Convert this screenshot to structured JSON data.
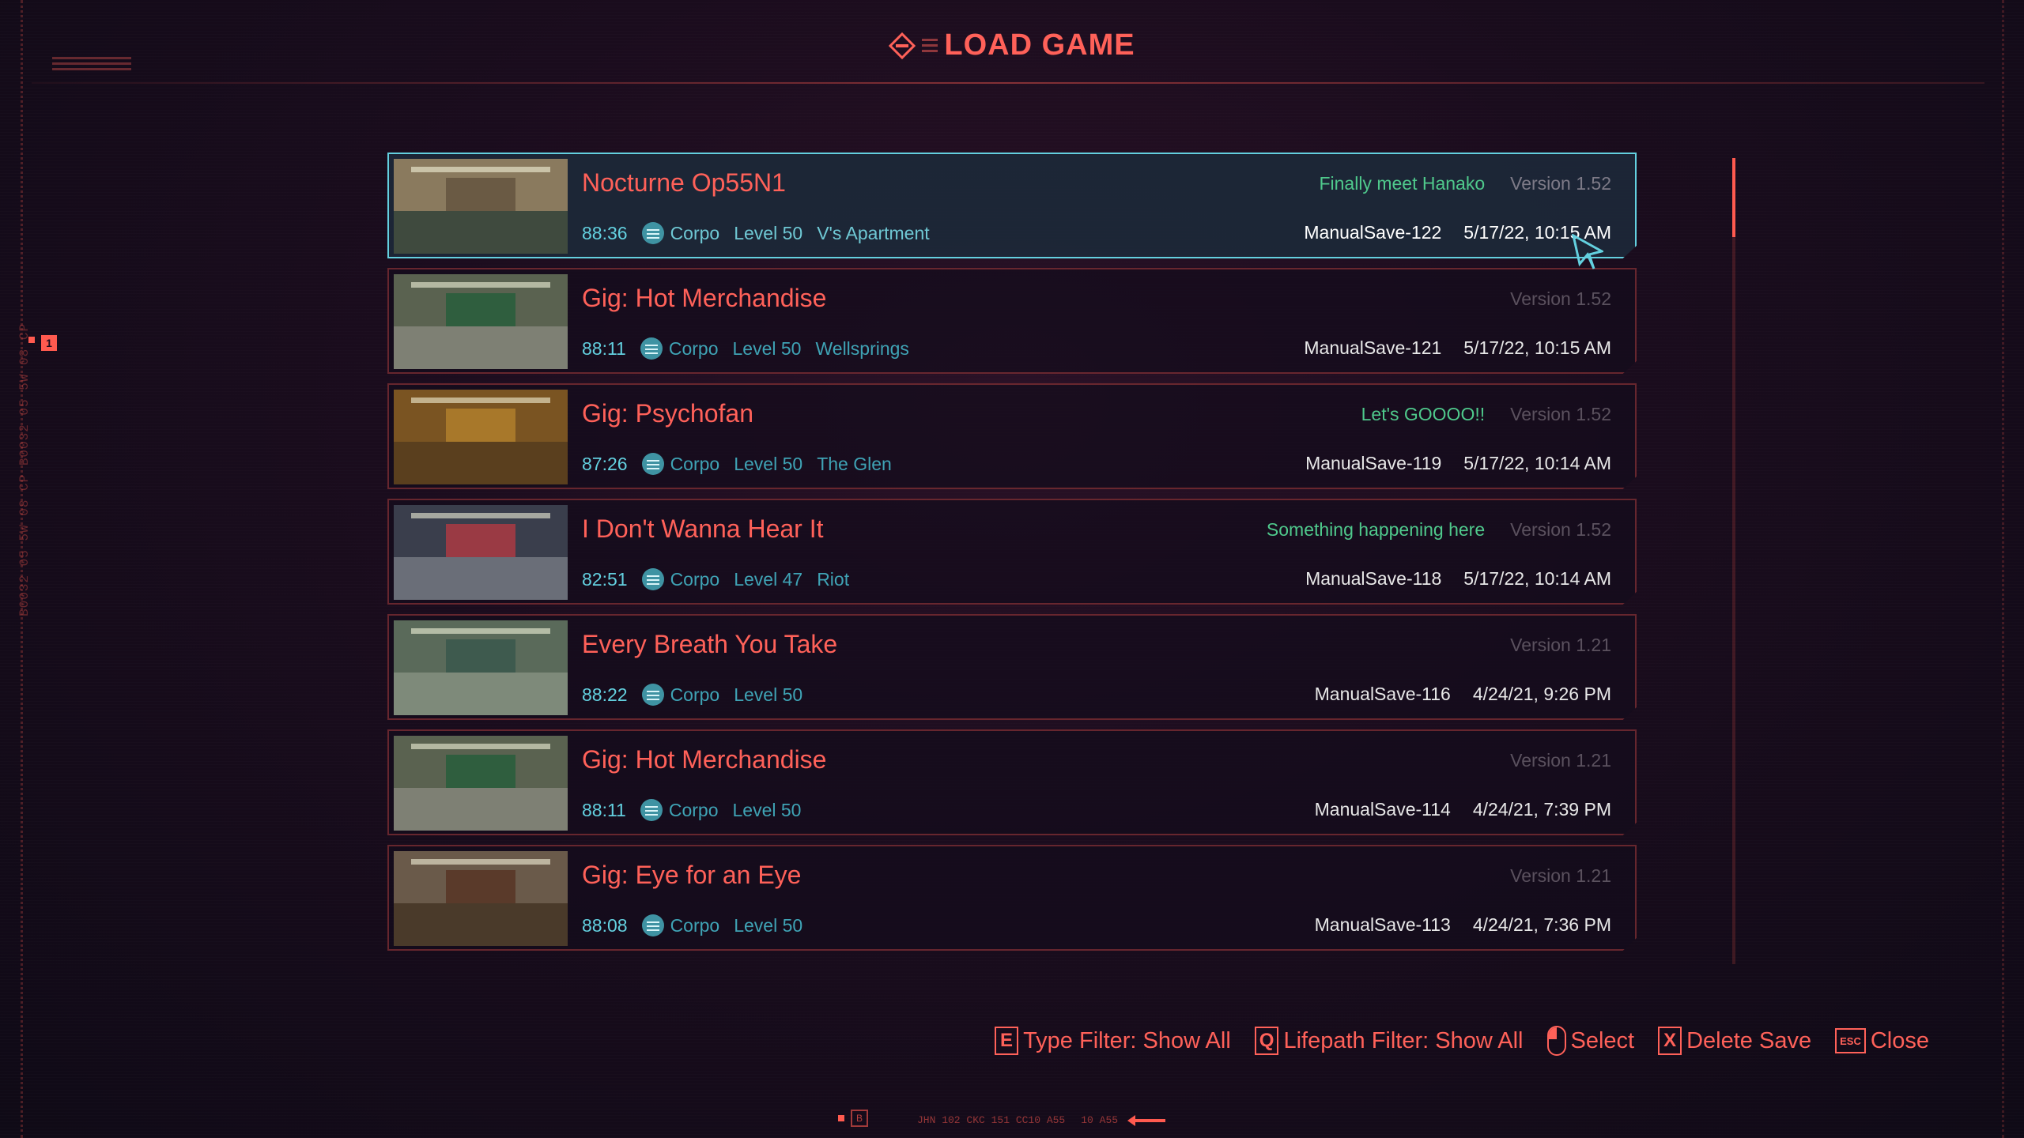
{
  "header": {
    "title": "LOAD GAME"
  },
  "saves": [
    {
      "name": "Nocturne Op55N1",
      "time": "88:36",
      "lifepath": "Corpo",
      "level": "Level 50",
      "location": "V's Apartment",
      "note": "Finally meet Hanako",
      "version": "Version 1.52",
      "save_id": "ManualSave-122",
      "date": "5/17/22, 10:15 AM",
      "selected": true,
      "thumb_colors": {
        "wall": "#6a5a44",
        "floor": "#3f4a3e",
        "bg": "#8a7a5e"
      }
    },
    {
      "name": "Gig: Hot Merchandise",
      "time": "88:11",
      "lifepath": "Corpo",
      "level": "Level 50",
      "location": "Wellsprings",
      "note": "",
      "version": "Version 1.52",
      "save_id": "ManualSave-121",
      "date": "5/17/22, 10:15 AM",
      "selected": false,
      "thumb_colors": {
        "wall": "#2f5e3e",
        "floor": "#7e8074",
        "bg": "#5a6250"
      }
    },
    {
      "name": "Gig: Psychofan",
      "time": "87:26",
      "lifepath": "Corpo",
      "level": "Level 50",
      "location": "The Glen",
      "note": "Let's GOOOO!!",
      "version": "Version 1.52",
      "save_id": "ManualSave-119",
      "date": "5/17/22, 10:14 AM",
      "selected": false,
      "thumb_colors": {
        "wall": "#a8782a",
        "floor": "#5a3f1e",
        "bg": "#7a5422"
      }
    },
    {
      "name": "I Don't Wanna Hear It",
      "time": "82:51",
      "lifepath": "Corpo",
      "level": "Level 47",
      "location": "Riot",
      "note": "Something happening here",
      "version": "Version 1.52",
      "save_id": "ManualSave-118",
      "date": "5/17/22, 10:14 AM",
      "selected": false,
      "thumb_colors": {
        "wall": "#9a3a44",
        "floor": "#6a6e78",
        "bg": "#3a3e4c"
      }
    },
    {
      "name": "Every Breath You Take",
      "time": "88:22",
      "lifepath": "Corpo",
      "level": "Level 50",
      "location": "",
      "note": "",
      "version": "Version 1.21",
      "save_id": "ManualSave-116",
      "date": "4/24/21, 9:26 PM",
      "selected": false,
      "thumb_colors": {
        "wall": "#3e5a4e",
        "floor": "#7e8a7a",
        "bg": "#5a6a5a"
      }
    },
    {
      "name": "Gig: Hot Merchandise",
      "time": "88:11",
      "lifepath": "Corpo",
      "level": "Level 50",
      "location": "",
      "note": "",
      "version": "Version 1.21",
      "save_id": "ManualSave-114",
      "date": "4/24/21, 7:39 PM",
      "selected": false,
      "thumb_colors": {
        "wall": "#2f5e3e",
        "floor": "#7e8074",
        "bg": "#5a6250"
      }
    },
    {
      "name": "Gig: Eye for an Eye",
      "time": "88:08",
      "lifepath": "Corpo",
      "level": "Level 50",
      "location": "",
      "note": "",
      "version": "Version 1.21",
      "save_id": "ManualSave-113",
      "date": "4/24/21, 7:36 PM",
      "selected": false,
      "thumb_colors": {
        "wall": "#5a3a2a",
        "floor": "#4a3a2a",
        "bg": "#6a5a4a"
      }
    }
  ],
  "footer": {
    "hints": [
      {
        "key": "E",
        "label": "Type Filter: Show All"
      },
      {
        "key": "Q",
        "label": "Lifepath Filter: Show All"
      },
      {
        "key": "mouse-icon",
        "label": "Select"
      },
      {
        "key": "X",
        "label": "Delete Save"
      },
      {
        "key": "ESC",
        "label": "Close"
      }
    ]
  },
  "decor": {
    "side_marker": "1",
    "bottom_box": "B",
    "bottom_code": "JHN 102 CKC 151 CC10 A55",
    "bottom_code2": "10 A55",
    "vertical_text": "B0032 05 5W 08 CP B0032 05 5W 08 CP"
  },
  "colors": {
    "accent": "#ff6159",
    "cyan": "#63d0df",
    "note_green": "#4fc98c",
    "bg": "#1a0c1d"
  }
}
